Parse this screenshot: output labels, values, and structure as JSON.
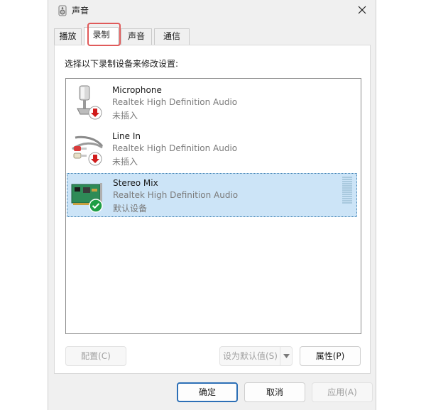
{
  "window": {
    "title": "声音",
    "close_label": "close"
  },
  "tabs": [
    {
      "label": "播放",
      "active": false
    },
    {
      "label": "录制",
      "active": true
    },
    {
      "label": "声音",
      "active": false
    },
    {
      "label": "通信",
      "active": false
    }
  ],
  "instruction": "选择以下录制设备来修改设置:",
  "devices": [
    {
      "name": "Microphone",
      "driver": "Realtek High Definition Audio",
      "status": "未插入",
      "icon": "microphone-icon",
      "badge": "red-down-arrow-icon",
      "selected": false
    },
    {
      "name": "Line In",
      "driver": "Realtek High Definition Audio",
      "status": "未插入",
      "icon": "line-in-cable-icon",
      "badge": "red-down-arrow-icon",
      "selected": false
    },
    {
      "name": "Stereo Mix",
      "driver": "Realtek High Definition Audio",
      "status": "默认设备",
      "icon": "sound-card-icon",
      "badge": "green-check-icon",
      "selected": true
    }
  ],
  "panel_buttons": {
    "configure": "配置(C)",
    "set_default": "设为默认值(S)",
    "properties": "属性(P)"
  },
  "footer_buttons": {
    "ok": "确定",
    "cancel": "取消",
    "apply": "应用(A)"
  },
  "colors": {
    "selection_bg": "#cce4f7",
    "highlight_box": "#e05a5a",
    "default_button_border": "#2c6fb6"
  }
}
